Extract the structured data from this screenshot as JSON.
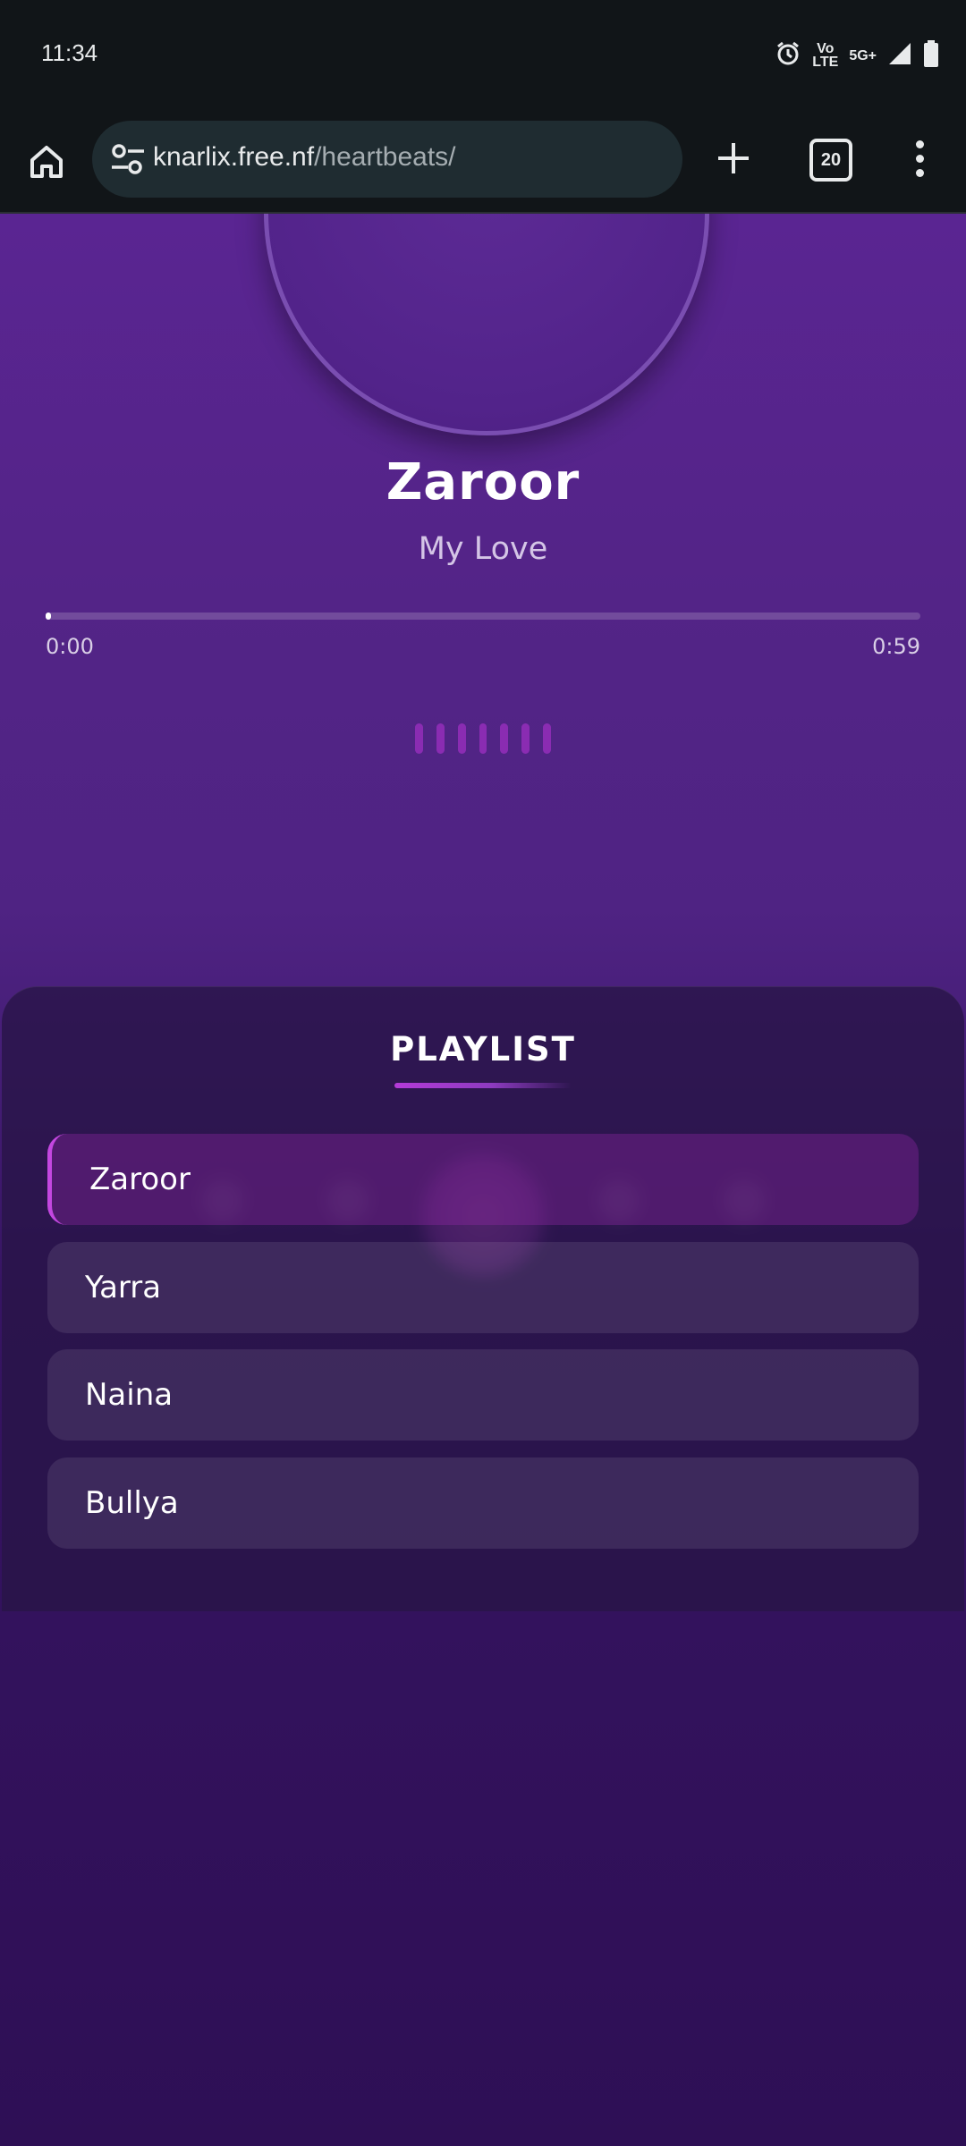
{
  "status_bar": {
    "time": "11:34",
    "volte_top": "Vo",
    "volte_bottom": "LTE",
    "network": "5G+"
  },
  "browser": {
    "url_domain": "knarlix.free.nf",
    "url_path": "/heartbeats/",
    "tab_count": "20"
  },
  "player": {
    "title": "Zaroor",
    "artist": "My Love",
    "current_time": "0:00",
    "total_time": "0:59",
    "progress_fraction": 0.005
  },
  "playlist": {
    "heading": "PLAYLIST",
    "items": [
      {
        "label": "Zaroor",
        "active": true
      },
      {
        "label": "Yarra",
        "active": false
      },
      {
        "label": "Naina",
        "active": false
      },
      {
        "label": "Bullya",
        "active": false
      }
    ]
  },
  "colors": {
    "accent": "#c347e0",
    "background": "#2e0f55"
  }
}
